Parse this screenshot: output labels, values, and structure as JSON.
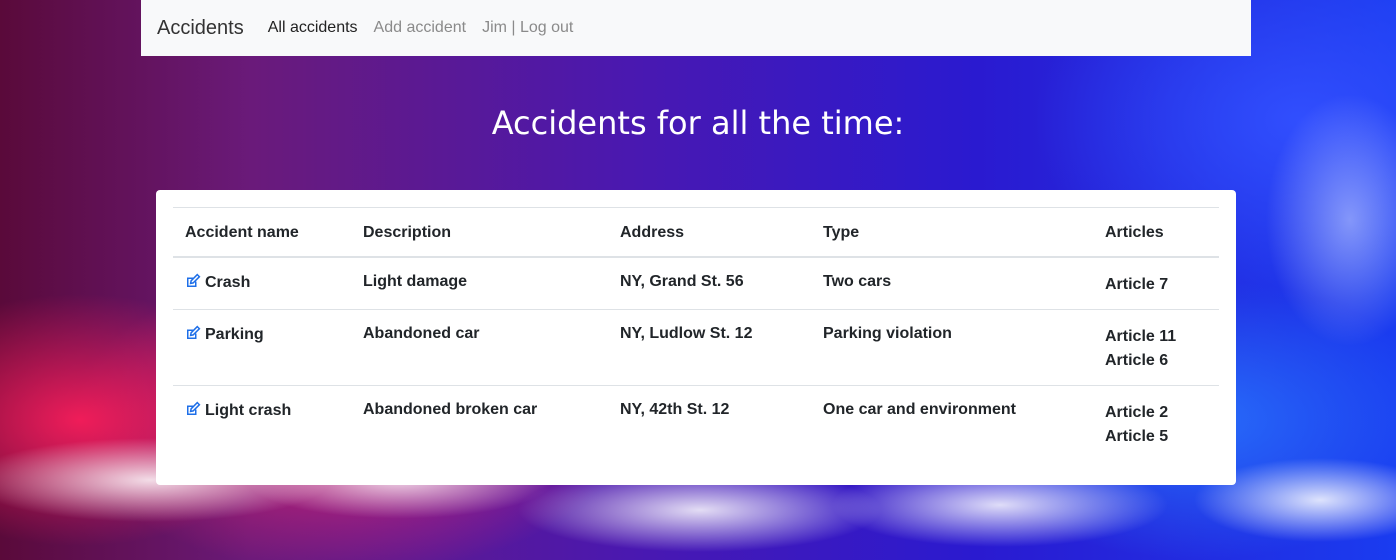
{
  "nav": {
    "brand": "Accidents",
    "links": [
      {
        "label": "All accidents"
      },
      {
        "label": "Add accident"
      },
      {
        "label": "Jim | Log out"
      }
    ]
  },
  "page": {
    "title": "Accidents for all the time:"
  },
  "table": {
    "headers": [
      "Accident name",
      "Description",
      "Address",
      "Type",
      "Articles"
    ],
    "rows": [
      {
        "name": "Crash",
        "description": "Light damage",
        "address": "NY, Grand St. 56",
        "type": "Two cars",
        "articles": [
          "Article 7"
        ]
      },
      {
        "name": "Parking",
        "description": "Abandoned car",
        "address": "NY, Ludlow St. 12",
        "type": "Parking violation",
        "articles": [
          "Article 11",
          "Article 6"
        ]
      },
      {
        "name": "Light crash",
        "description": "Abandoned broken car",
        "address": "NY, 42th St. 12",
        "type": "One car and environment",
        "articles": [
          "Article 2",
          "Article 5"
        ]
      }
    ]
  },
  "icons": {
    "edit": "edit-icon"
  },
  "colors": {
    "accent": "#1e6fe8",
    "navbar_bg": "#f8f9fa"
  }
}
